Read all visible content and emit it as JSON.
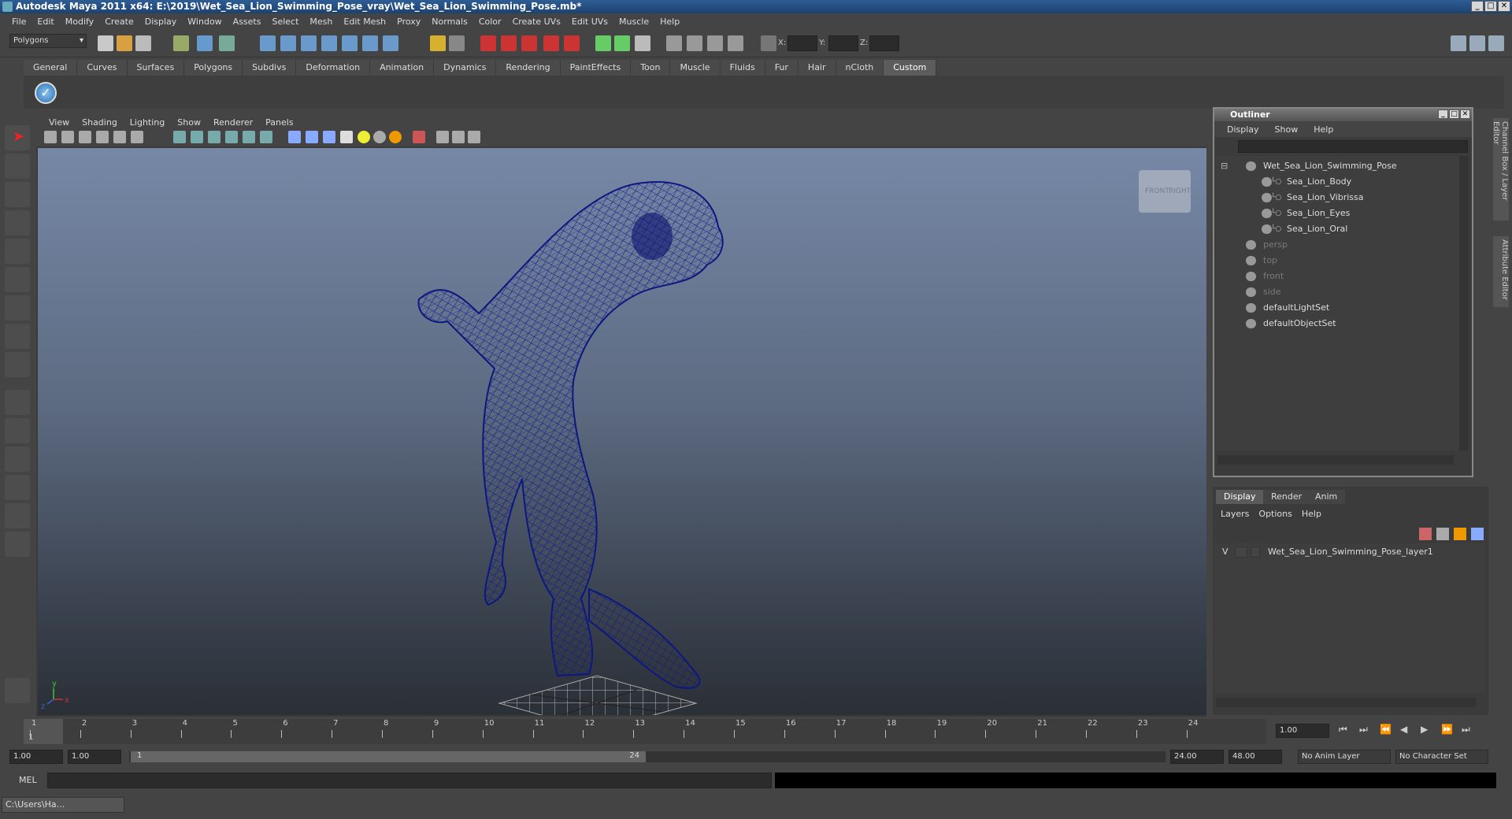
{
  "window": {
    "title": "Autodesk Maya 2011 x64: E:\\2019\\Wet_Sea_Lion_Swimming_Pose_vray\\Wet_Sea_Lion_Swimming_Pose.mb*"
  },
  "menubar": [
    "File",
    "Edit",
    "Modify",
    "Create",
    "Display",
    "Window",
    "Assets",
    "Select",
    "Mesh",
    "Edit Mesh",
    "Proxy",
    "Normals",
    "Color",
    "Create UVs",
    "Edit UVs",
    "Muscle",
    "Help"
  ],
  "statusline": {
    "mode": "Polygons",
    "x_label": "X:",
    "y_label": "Y:",
    "z_label": "Z:"
  },
  "shelf_tabs": [
    "General",
    "Curves",
    "Surfaces",
    "Polygons",
    "Subdivs",
    "Deformation",
    "Animation",
    "Dynamics",
    "Rendering",
    "PaintEffects",
    "Toon",
    "Muscle",
    "Fluids",
    "Fur",
    "Hair",
    "nCloth",
    "Custom"
  ],
  "shelf_active": "Custom",
  "viewport": {
    "menu": [
      "View",
      "Shading",
      "Lighting",
      "Show",
      "Renderer",
      "Panels"
    ],
    "viewcube": {
      "front": "FRONT",
      "right": "RIGHT"
    },
    "axis": {
      "x": "x",
      "y": "y",
      "z": "z"
    }
  },
  "outliner": {
    "title": "Outliner",
    "menu": [
      "Display",
      "Show",
      "Help"
    ],
    "items": [
      {
        "label": "Wet_Sea_Lion_Swimming_Pose",
        "indent": 0,
        "dim": false
      },
      {
        "label": "Sea_Lion_Body",
        "indent": 1,
        "dim": false
      },
      {
        "label": "Sea_Lion_Vibrissa",
        "indent": 1,
        "dim": false
      },
      {
        "label": "Sea_Lion_Eyes",
        "indent": 1,
        "dim": false
      },
      {
        "label": "Sea_Lion_Oral",
        "indent": 1,
        "dim": false
      },
      {
        "label": "persp",
        "indent": 0,
        "dim": true
      },
      {
        "label": "top",
        "indent": 0,
        "dim": true
      },
      {
        "label": "front",
        "indent": 0,
        "dim": true
      },
      {
        "label": "side",
        "indent": 0,
        "dim": true
      },
      {
        "label": "defaultLightSet",
        "indent": 0,
        "dim": false
      },
      {
        "label": "defaultObjectSet",
        "indent": 0,
        "dim": false
      }
    ]
  },
  "side_tabs": {
    "channel": "Channel Box / Layer Editor",
    "attribute": "Attribute Editor"
  },
  "layers": {
    "tabs": [
      "Display",
      "Render",
      "Anim"
    ],
    "active": "Display",
    "menu": [
      "Layers",
      "Options",
      "Help"
    ],
    "layer_visible": "V",
    "layer_name": "Wet_Sea_Lion_Swimming_Pose_layer1"
  },
  "timeline": {
    "ticks": [
      "1",
      "2",
      "3",
      "4",
      "5",
      "6",
      "7",
      "8",
      "9",
      "10",
      "11",
      "12",
      "13",
      "14",
      "15",
      "16",
      "17",
      "18",
      "19",
      "20",
      "21",
      "22",
      "23",
      "24"
    ],
    "current_frame": "1.00",
    "current_marker": "1"
  },
  "range": {
    "start": "1.00",
    "playback_start": "1.00",
    "slider_start": "1",
    "slider_end": "24",
    "playback_end": "24.00",
    "end": "48.00",
    "anim_layer": "No Anim Layer",
    "character_set": "No Character Set"
  },
  "command": {
    "label": "MEL"
  },
  "taskbar": {
    "item": "C:\\Users\\Ha..."
  }
}
